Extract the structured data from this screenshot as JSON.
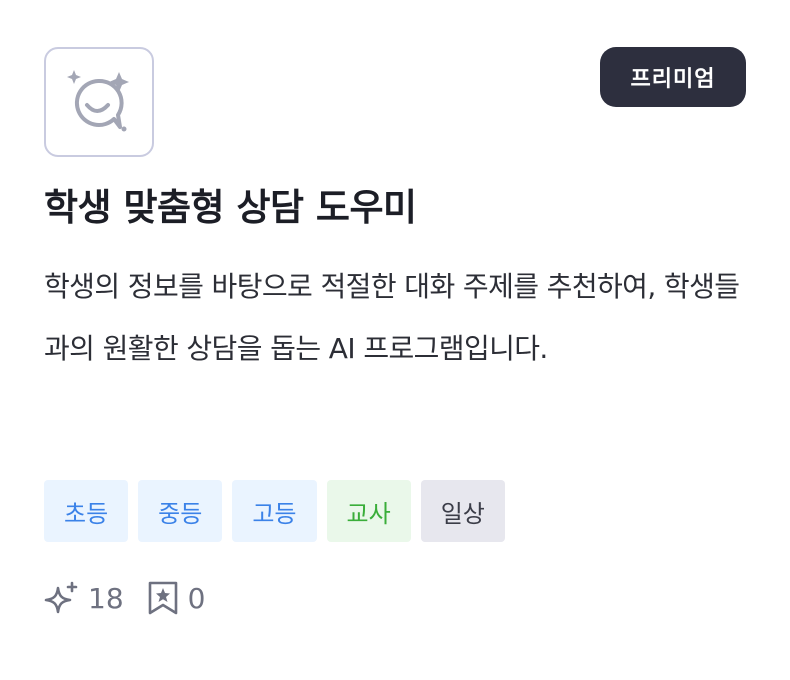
{
  "card": {
    "badge": "프리미엄",
    "title": "학생 맞춤형 상담 도우미",
    "description": "학생의 정보를 바탕으로 적절한 대화 주제를 추천하여, 학생들과의 원활한 상담을 돕는 AI 프로그램입니다.",
    "icon": "smiling-chat-sparkle-icon",
    "tags": [
      {
        "label": "초등",
        "color": "#3b82e8"
      },
      {
        "label": "중등",
        "color": "#3b82e8"
      },
      {
        "label": "고등",
        "color": "#3b82e8"
      },
      {
        "label": "교사",
        "color": "#3aae3a"
      },
      {
        "label": "일상",
        "color": "#3b3d48"
      }
    ],
    "stats": {
      "sparkle_count": "18",
      "bookmark_count": "0"
    }
  }
}
